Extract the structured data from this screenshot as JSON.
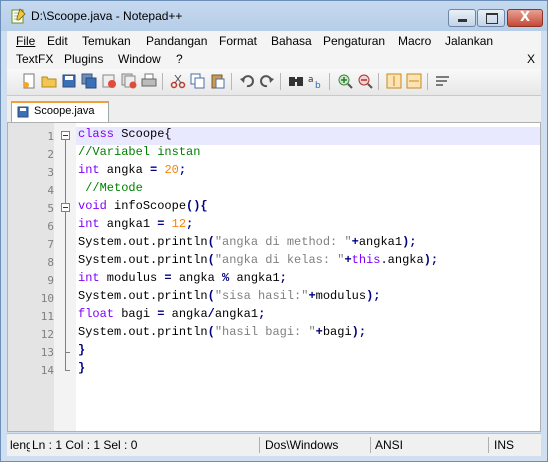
{
  "window": {
    "title": "D:\\Scoope.java - Notepad++",
    "close_glyph": "X"
  },
  "menu": {
    "row1": [
      "File",
      "Edit",
      "Temukan",
      "Pandangan",
      "Format",
      "Bahasa",
      "Pengaturan",
      "Macro",
      "Jalankan"
    ],
    "row2": [
      "TextFX",
      "Plugins",
      "Window",
      "?"
    ]
  },
  "toolbar_icons": [
    "new-icon",
    "open-icon",
    "save-icon",
    "save-all-icon",
    "close-icon",
    "close-all-icon",
    "print-icon",
    "cut-icon",
    "copy-icon",
    "paste-icon",
    "undo-icon",
    "redo-icon",
    "find-icon",
    "replace-icon",
    "zoom-in-icon",
    "zoom-out-icon",
    "sync-v-icon",
    "sync-h-icon",
    "wrap-icon"
  ],
  "tab": {
    "label": "Scoope.java"
  },
  "editor": {
    "line_numbers": [
      "1",
      "2",
      "3",
      "4",
      "5",
      "6",
      "7",
      "8",
      "9",
      "10",
      "11",
      "12",
      "13",
      "14"
    ],
    "lines": [
      [
        {
          "t": "class",
          "c": "kw"
        },
        {
          "t": " Scoope{",
          "c": ""
        }
      ],
      [
        {
          "t": "//Variabel instan",
          "c": "cm"
        }
      ],
      [
        {
          "t": "int",
          "c": "kw"
        },
        {
          "t": " angka ",
          "c": ""
        },
        {
          "t": "=",
          "c": "op"
        },
        {
          "t": " ",
          "c": ""
        },
        {
          "t": "20",
          "c": "num"
        },
        {
          "t": ";",
          "c": "op"
        }
      ],
      [
        {
          "t": " //Metode",
          "c": "cm"
        }
      ],
      [
        {
          "t": "void",
          "c": "kw"
        },
        {
          "t": " infoScoope",
          "c": ""
        },
        {
          "t": "(){",
          "c": "op"
        }
      ],
      [
        {
          "t": "int",
          "c": "kw"
        },
        {
          "t": " angka1 ",
          "c": ""
        },
        {
          "t": "=",
          "c": "op"
        },
        {
          "t": " ",
          "c": ""
        },
        {
          "t": "12",
          "c": "num"
        },
        {
          "t": ";",
          "c": "op"
        }
      ],
      [
        {
          "t": "System.out.println",
          "c": ""
        },
        {
          "t": "(",
          "c": "op"
        },
        {
          "t": "\"angka di method: \"",
          "c": "str"
        },
        {
          "t": "+",
          "c": "op"
        },
        {
          "t": "angka1",
          "c": ""
        },
        {
          "t": ");",
          "c": "op"
        }
      ],
      [
        {
          "t": "System.out.println",
          "c": ""
        },
        {
          "t": "(",
          "c": "op"
        },
        {
          "t": "\"angka di kelas: \"",
          "c": "str"
        },
        {
          "t": "+",
          "c": "op"
        },
        {
          "t": "this",
          "c": "kw"
        },
        {
          "t": ".angka",
          "c": ""
        },
        {
          "t": ");",
          "c": "op"
        }
      ],
      [
        {
          "t": "int",
          "c": "kw"
        },
        {
          "t": " modulus ",
          "c": ""
        },
        {
          "t": "=",
          "c": "op"
        },
        {
          "t": " angka ",
          "c": ""
        },
        {
          "t": "%",
          "c": "op"
        },
        {
          "t": " angka1",
          "c": ""
        },
        {
          "t": ";",
          "c": "op"
        }
      ],
      [
        {
          "t": "System.out.println",
          "c": ""
        },
        {
          "t": "(",
          "c": "op"
        },
        {
          "t": "\"sisa hasil:\"",
          "c": "str"
        },
        {
          "t": "+",
          "c": "op"
        },
        {
          "t": "modulus",
          "c": ""
        },
        {
          "t": ");",
          "c": "op"
        }
      ],
      [
        {
          "t": "float",
          "c": "kw"
        },
        {
          "t": " bagi ",
          "c": ""
        },
        {
          "t": "=",
          "c": "op"
        },
        {
          "t": " angka",
          "c": ""
        },
        {
          "t": "/",
          "c": "op"
        },
        {
          "t": "angka1",
          "c": ""
        },
        {
          "t": ";",
          "c": "op"
        }
      ],
      [
        {
          "t": "System.out.println",
          "c": ""
        },
        {
          "t": "(",
          "c": "op"
        },
        {
          "t": "\"hasil bagi: \"",
          "c": "str"
        },
        {
          "t": "+",
          "c": "op"
        },
        {
          "t": "bagi",
          "c": ""
        },
        {
          "t": ");",
          "c": "op"
        }
      ],
      [
        {
          "t": "}",
          "c": "op"
        }
      ],
      [
        {
          "t": "}",
          "c": "op"
        }
      ]
    ]
  },
  "status": {
    "lang": "leng",
    "pos": "Ln : 1    Col : 1    Sel : 0",
    "eol": "Dos\\Windows",
    "encoding": "ANSI",
    "mode": "INS"
  },
  "colors": {
    "keyword": "#8000ff",
    "comment": "#008000",
    "number": "#ff8000",
    "string": "#808080",
    "operator": "#000080",
    "current_line": "#e8e8ff",
    "tab_accent": "#f2a03c"
  }
}
